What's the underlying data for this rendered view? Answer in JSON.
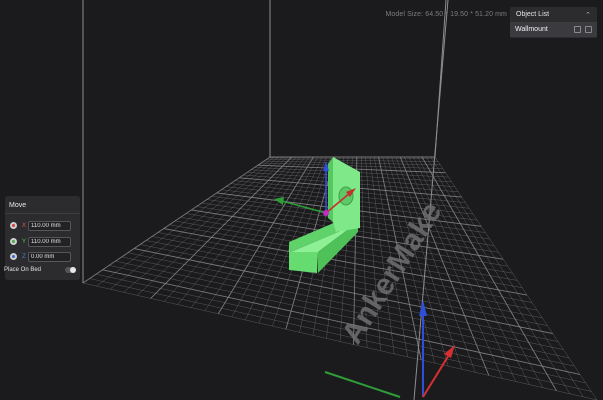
{
  "model_size": "Model Size: 64.50 * 19.50 * 51.20 mm",
  "object_list": {
    "title": "Object List",
    "collapse_icon": "chevron-up-icon",
    "items": [
      {
        "name": "Wallmount",
        "icons": [
          "eye-icon",
          "settings-icon"
        ]
      }
    ]
  },
  "move_panel": {
    "title": "Move",
    "axes": [
      {
        "letter": "X",
        "value": "110.00 mm",
        "color": "#d84040"
      },
      {
        "letter": "Y",
        "value": "110.00 mm",
        "color": "#3fae45"
      },
      {
        "letter": "Z",
        "value": "0.00 mm",
        "color": "#3f66d8"
      }
    ],
    "place_on_bed_label": "Place On Bed",
    "place_on_bed_enabled": true
  },
  "bed": {
    "watermark": "AnkerMake",
    "grid_color": "#8a8a8e",
    "model_color": "#79e882"
  }
}
